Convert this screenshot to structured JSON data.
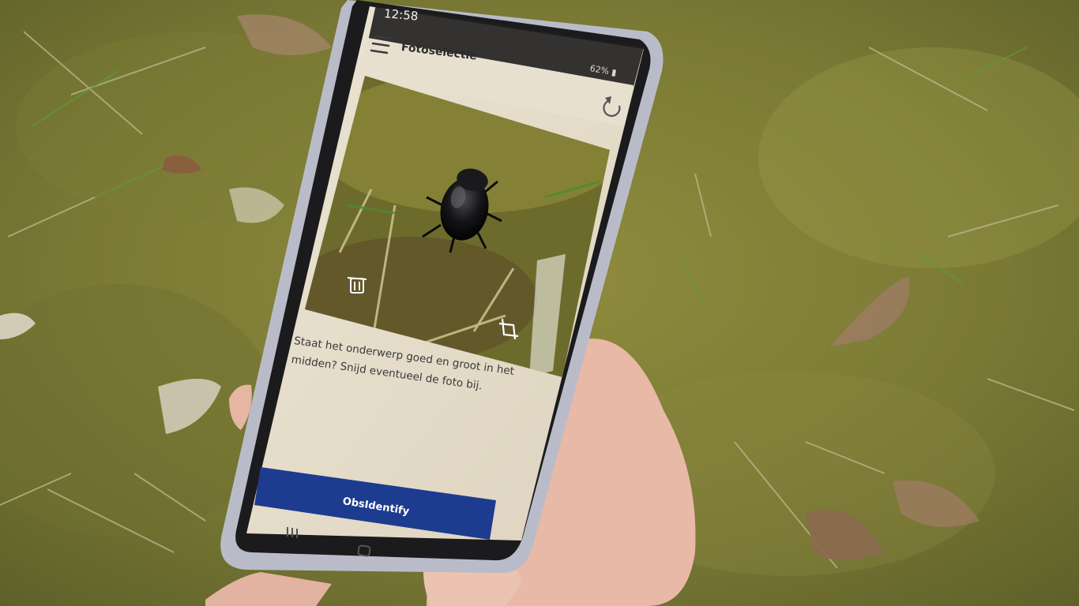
{
  "status_bar": {
    "time": "12:58",
    "right": "62% ▮"
  },
  "app": {
    "title": "Fotoselectie",
    "instruction": "Staat het onderwerp goed en groot in het midden? Snijd eventueel de foto bij.",
    "primary_button": "ObsIdentify"
  },
  "colors": {
    "button": "#1d3c8f",
    "screen_bg": "#e6dcc9",
    "moss": "#8c8a3a"
  }
}
